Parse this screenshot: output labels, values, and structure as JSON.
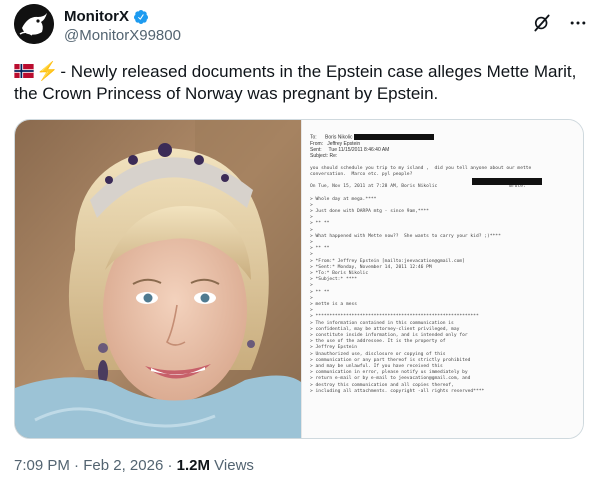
{
  "author": {
    "display_name": "MonitorX",
    "handle": "@MonitorX99800",
    "verified": true,
    "avatar_icon": "bird-logo-avatar"
  },
  "header_actions": {
    "grok_icon": "grok-icon",
    "more_icon": "more-icon"
  },
  "tweet": {
    "emoji_flag": "norway-flag",
    "emoji_bolt": "⚡",
    "text": "- Newly released documents in the Epstein case alleges Mette Marit, the Crown Princess of Norway was pregnant by Epstein."
  },
  "document": {
    "to_label": "To:",
    "to_value": "Boris Nikolic",
    "from_label": "From:",
    "from_value": "Jeffrey Epstein",
    "sent_label": "Sent:",
    "sent_value": "Tue 11/15/2011 8:46:40 AM",
    "subject_label": "Subject:",
    "subject_value": "Re:",
    "body": [
      "you should schedule you trip to my island ,  did you tell anyone about our mette",
      "conversation.  Marco etc. pyl people?",
      "",
      "On Tue, Nov 15, 2011 at 7:28 AM, Boris Nikolic                          wrote:",
      "",
      "> Whole day at mega.****",
      ">",
      "> Just done with DARPA mtg - since 9am,****",
      ">",
      "> ** **",
      ">",
      "> What happened with Mette now??  She wants to carry your kid? ;)****",
      ">",
      "> ** **",
      ">",
      "> *From:* Jeffrey Epstein [mailto:jeevacation@gmail.com]",
      "> *Sent:* Monday, November 14, 2011 12:46 PM",
      "> *To:* Boris Nikolic",
      "> *Subject:* ****",
      ">",
      "> ** **",
      ">",
      "> mette is a mess",
      ">",
      "> ***********************************************************",
      "> The information contained in this communication is",
      "> confidential, may be attorney-client privileged, may",
      "> constitute inside information, and is intended only for",
      "> the use of the addressee. It is the property of",
      "> Jeffrey Epstein",
      "> Unauthorized use, disclosure or copying of this",
      "> communication or any part thereof is strictly prohibited",
      "> and may be unlawful. If you have received this",
      "> communication in error, please notify us immediately by",
      "> return e-mail or by e-mail to jeevacation@gmail.com, and",
      "> destroy this communication and all copies thereof,",
      "> including all attachments. copyright -all rights reserved****"
    ]
  },
  "meta": {
    "time": "7:09 PM",
    "sep": "·",
    "date": "Feb 2, 2026",
    "views_count": "1.2M",
    "views_label": "Views"
  },
  "colors": {
    "text": "#0f1419",
    "secondary": "#536471",
    "verified_blue": "#1d9bf0",
    "border": "#cfd9de"
  }
}
